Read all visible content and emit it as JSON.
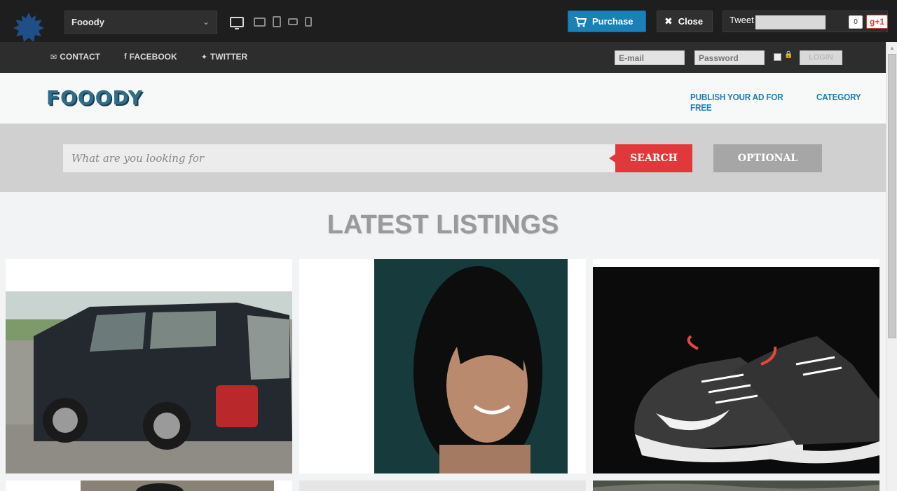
{
  "demobar": {
    "theme_select": "Fooody",
    "devices": [
      "desktop-icon",
      "tablet-landscape-icon",
      "tablet-portrait-icon",
      "phone-landscape-icon",
      "phone-portrait-icon"
    ],
    "purchase_label": "Purchase",
    "close_label": "Close",
    "tweet_label": "Tweet",
    "gplus_count": "0",
    "gplus_label": "g+1"
  },
  "topnav": {
    "links": [
      {
        "icon": "envelope-icon",
        "label": "CONTACT"
      },
      {
        "icon": "facebook-icon",
        "label": "FACEBOOK"
      },
      {
        "icon": "twitter-icon",
        "label": "TWITTER"
      }
    ],
    "email_placeholder": "E-mail",
    "password_placeholder": "Password",
    "login_label": "LOGIN"
  },
  "header": {
    "brand": "FOOODY",
    "nav": [
      "PUBLISH YOUR AD FOR FREE",
      "CATEGORY"
    ]
  },
  "search": {
    "placeholder": "What are you looking for",
    "button_label": "SEARCH",
    "optional_label": "OPTIONAL"
  },
  "listings": {
    "title": "LATEST LISTINGS"
  },
  "colors": {
    "accent_blue": "#1a80b8",
    "search_red": "#e1393b",
    "dark_bar": "#1e1e1e"
  }
}
